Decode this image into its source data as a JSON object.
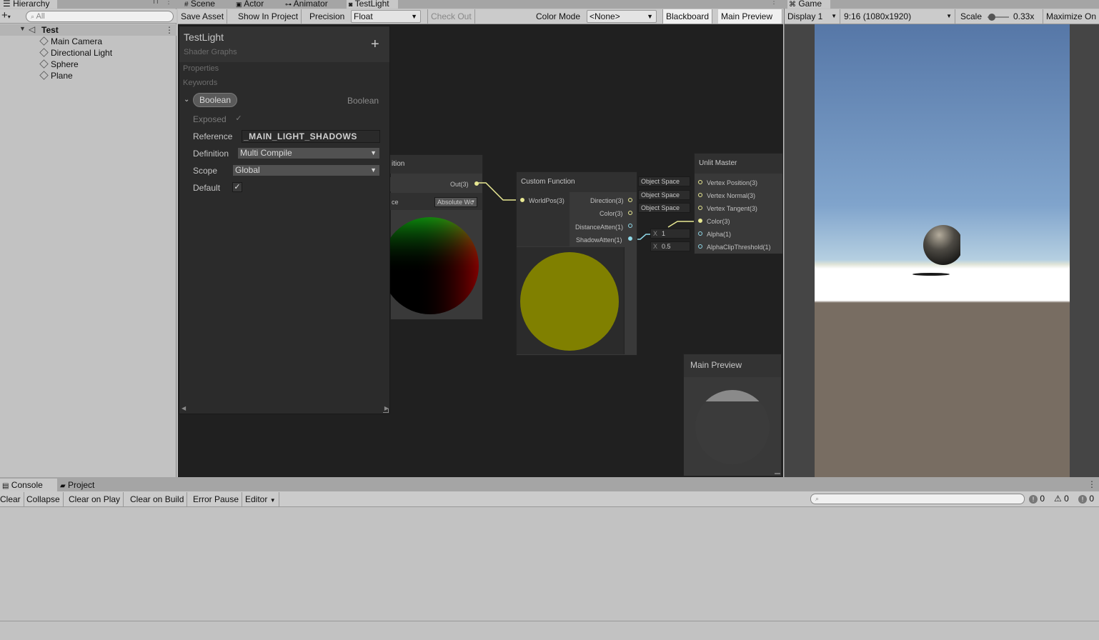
{
  "hierarchy": {
    "tab_label": "Hierarchy",
    "search_placeholder": "All",
    "scene_name": "Test",
    "items": [
      "Main Camera",
      "Directional Light",
      "Sphere",
      "Plane"
    ]
  },
  "center_tabs": [
    "Scene",
    "Actor",
    "Animator",
    "TestLight"
  ],
  "shader_toolbar": {
    "save_asset": "Save Asset",
    "show_in_project": "Show In Project",
    "precision_label": "Precision",
    "precision_value": "Float",
    "check_out": "Check Out",
    "color_mode_label": "Color Mode",
    "color_mode_value": "<None>",
    "blackboard": "Blackboard",
    "main_preview": "Main Preview"
  },
  "blackboard": {
    "title": "TestLight",
    "subtitle": "Shader Graphs",
    "add_symbol": "+",
    "properties": "Properties",
    "keywords": "Keywords",
    "keyword_name": "Boolean",
    "keyword_type": "Boolean",
    "exposed_label": "Exposed",
    "reference_label": "Reference",
    "reference_value": "_MAIN_LIGHT_SHADOWS",
    "definition_label": "Definition",
    "definition_value": "Multi Compile",
    "scope_label": "Scope",
    "scope_value": "Global",
    "default_label": "Default"
  },
  "graph": {
    "position_node": {
      "title_fragment": "ition",
      "out_port": "Out(3)",
      "space_fragment": "ce",
      "space_value": "Absolute Wc"
    },
    "custom_function": {
      "title": "Custom Function",
      "input": "WorldPos(3)",
      "outputs": [
        "Direction(3)",
        "Color(3)",
        "DistanceAtten(1)",
        "ShadowAtten(1)"
      ]
    },
    "master": {
      "title": "Unlit Master",
      "inputs": [
        "Vertex Position(3)",
        "Vertex Normal(3)",
        "Vertex Tangent(3)",
        "Color(3)",
        "Alpha(1)",
        "AlphaClipThreshold(1)"
      ],
      "space_fields": [
        "Object Space",
        "Object Space",
        "Object Space"
      ],
      "alpha_axis": "X",
      "alpha_value": "1",
      "clip_axis": "X",
      "clip_value": "0.5"
    },
    "main_preview_title": "Main Preview",
    "colors": {
      "preview_yellow": "#808000"
    }
  },
  "game": {
    "tab_label": "Game",
    "display": "Display 1",
    "resolution": "9:16 (1080x1920)",
    "scale_label": "Scale",
    "scale_value": "0.33x",
    "maximize": "Maximize On"
  },
  "console": {
    "tabs": [
      "Console",
      "Project"
    ],
    "buttons": [
      "Clear",
      "Collapse",
      "Clear on Play",
      "Clear on Build",
      "Error Pause",
      "Editor"
    ],
    "counts": [
      "0",
      "0",
      "0"
    ]
  }
}
